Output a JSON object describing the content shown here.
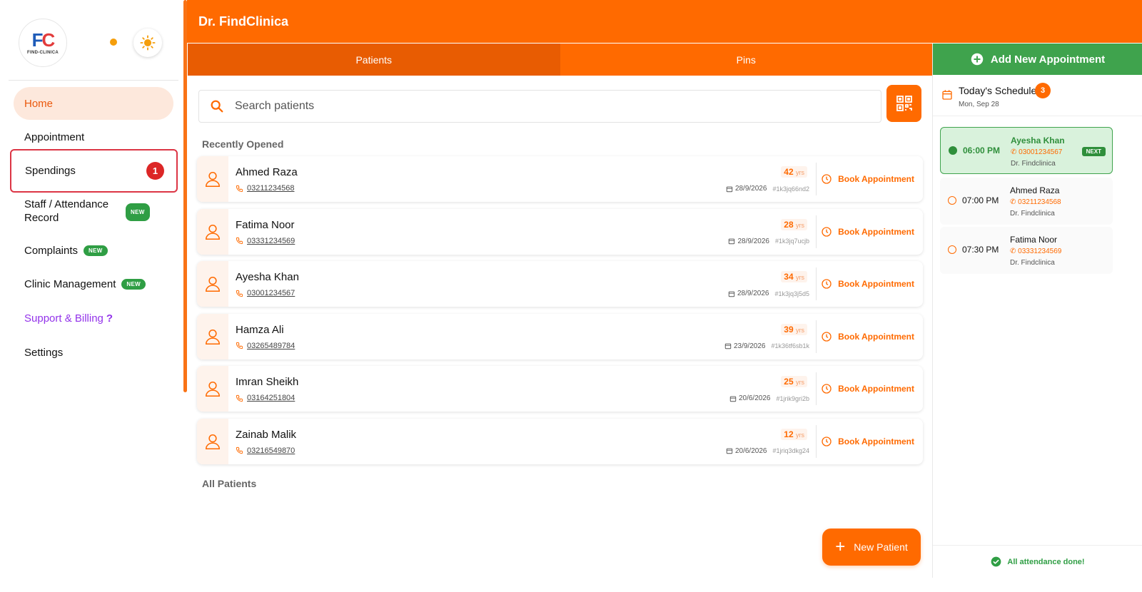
{
  "app": {
    "title": "Dr. FindClinica"
  },
  "logo": {
    "mark_left": "F",
    "mark_right": "C",
    "text": "FIND-CLINICA"
  },
  "sidebar": {
    "items": [
      {
        "label": "Home"
      },
      {
        "label": "Appointment"
      },
      {
        "label": "Spendings",
        "badge": "1"
      },
      {
        "label": "Staff / Attendance Record",
        "badge": "NEW"
      },
      {
        "label": "Complaints",
        "badge": "NEW"
      },
      {
        "label": "Clinic Management",
        "badge": "NEW"
      },
      {
        "label": "Support & Billing",
        "suffix": "?"
      },
      {
        "label": "Settings"
      }
    ]
  },
  "tabs": [
    {
      "label": "Patients"
    },
    {
      "label": "Pins"
    }
  ],
  "search": {
    "placeholder": "Search patients"
  },
  "sections": {
    "recent": "Recently Opened",
    "all": "All Patients"
  },
  "patients": [
    {
      "name": "Ahmed Raza",
      "phone": "03211234568",
      "age": "42",
      "age_unit": "yrs",
      "date": "28/9/2026",
      "id": "#1k3jq66nd2",
      "action": "Book Appointment"
    },
    {
      "name": "Fatima Noor",
      "phone": "03331234569",
      "age": "28",
      "age_unit": "yrs",
      "date": "28/9/2026",
      "id": "#1k3jq7ucjb",
      "action": "Book Appointment"
    },
    {
      "name": "Ayesha Khan",
      "phone": "03001234567",
      "age": "34",
      "age_unit": "yrs",
      "date": "28/9/2026",
      "id": "#1k3jq3j5d5",
      "action": "Book Appointment"
    },
    {
      "name": "Hamza Ali",
      "phone": "03265489784",
      "age": "39",
      "age_unit": "yrs",
      "date": "23/9/2026",
      "id": "#1k36tf6sb1k",
      "action": "Book Appointment"
    },
    {
      "name": "Imran Sheikh",
      "phone": "03164251804",
      "age": "25",
      "age_unit": "yrs",
      "date": "20/6/2026",
      "id": "#1jrik9gri2b",
      "action": "Book Appointment"
    },
    {
      "name": "Zainab Malik",
      "phone": "03216549870",
      "age": "12",
      "age_unit": "yrs",
      "date": "20/6/2026",
      "id": "#1jriq3dkg24",
      "action": "Book Appointment"
    }
  ],
  "new_patient": {
    "label": "New Patient"
  },
  "right": {
    "add_label": "Add New Appointment",
    "schedule_title": "Today's Schedule",
    "schedule_count": "3",
    "schedule_date": "Mon, Sep 28",
    "appointments": [
      {
        "time": "06:00 PM",
        "name": "Ayesha Khan",
        "phone": "03001234567",
        "doctor": "Dr. Findclinica",
        "badge": "NEXT"
      },
      {
        "time": "07:00 PM",
        "name": "Ahmed Raza",
        "phone": "03211234568",
        "doctor": "Dr. Findclinica"
      },
      {
        "time": "07:30 PM",
        "name": "Fatima Noor",
        "phone": "03331234569",
        "doctor": "Dr. Findclinica"
      }
    ],
    "footer": "All attendance done!"
  },
  "colors": {
    "brand": "#ff6a00",
    "success": "#3fa34d",
    "danger": "#dc2626",
    "support": "#9333ea"
  }
}
